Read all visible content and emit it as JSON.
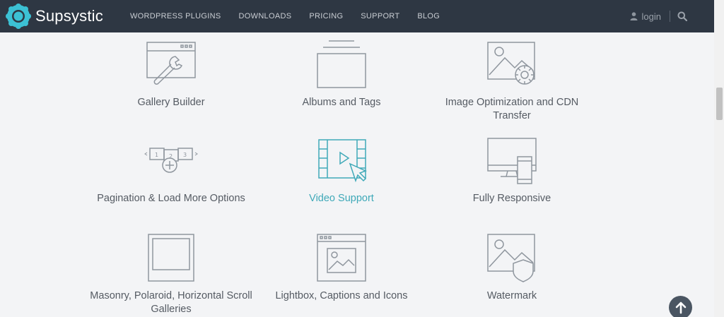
{
  "brand": {
    "name": "Supsystic"
  },
  "nav": {
    "items": [
      {
        "label": "WORDPRESS PLUGINS"
      },
      {
        "label": "DOWNLOADS"
      },
      {
        "label": "PRICING"
      },
      {
        "label": "SUPPORT"
      },
      {
        "label": "BLOG"
      }
    ],
    "login_label": "login"
  },
  "features": [
    {
      "label": "Gallery Builder",
      "icon": "wrench-window-icon",
      "active": false
    },
    {
      "label": "Albums and Tags",
      "icon": "album-stack-icon",
      "active": false
    },
    {
      "label": "Image Optimization and CDN Transfer",
      "icon": "image-gear-icon",
      "active": false
    },
    {
      "label": "Pagination & Load More Options",
      "icon": "pagination-icon",
      "active": false
    },
    {
      "label": "Video Support",
      "icon": "video-cursor-icon",
      "active": true
    },
    {
      "label": "Fully Responsive",
      "icon": "devices-icon",
      "active": false
    },
    {
      "label": "Masonry, Polaroid, Horizontal Scroll Galleries",
      "icon": "polaroid-frame-icon",
      "active": false
    },
    {
      "label": "Lightbox, Captions and Icons",
      "icon": "lightbox-window-icon",
      "active": false
    },
    {
      "label": "Watermark",
      "icon": "image-shield-icon",
      "active": false
    }
  ],
  "colors": {
    "navbar": "#2e3743",
    "background": "#f3f4f6",
    "icon_stroke": "#8f969e",
    "accent": "#3fa9b8",
    "text": "#555b63"
  }
}
